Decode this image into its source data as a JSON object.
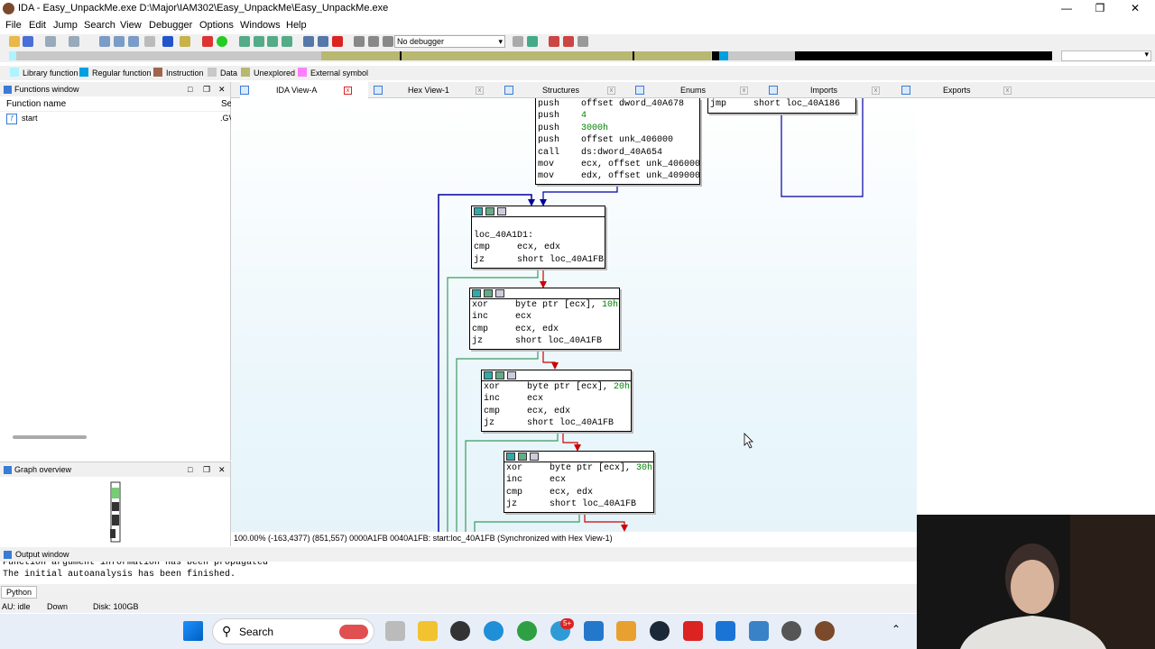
{
  "window": {
    "title": "IDA - Easy_UnpackMe.exe D:\\Major\\IAM302\\Easy_UnpackMe\\Easy_UnpackMe.exe"
  },
  "menu": [
    "File",
    "Edit",
    "Jump",
    "Search",
    "View",
    "Debugger",
    "Options",
    "Windows",
    "Help"
  ],
  "toolbar": {
    "debugger_select": "No debugger"
  },
  "legend": [
    {
      "label": "Library function",
      "color": "#aef4ff"
    },
    {
      "label": "Regular function",
      "color": "#00a0e0"
    },
    {
      "label": "Instruction",
      "color": "#a0644e"
    },
    {
      "label": "Data",
      "color": "#c8c8c8"
    },
    {
      "label": "Unexplored",
      "color": "#b8b870"
    },
    {
      "label": "External symbol",
      "color": "#ff80ff"
    }
  ],
  "tabs": [
    "IDA View-A",
    "Hex View-1",
    "Structures",
    "Enums",
    "Imports",
    "Exports"
  ],
  "functions_window": {
    "title": "Functions window",
    "col_name": "Function name",
    "col_seg": "Se",
    "rows": [
      {
        "name": "start",
        "seg": ".GV"
      }
    ]
  },
  "graph_overview": {
    "title": "Graph overview"
  },
  "blocks": {
    "top": [
      {
        "m": "push",
        "o": "offset dword_40A678"
      },
      {
        "m": "push",
        "o": "4"
      },
      {
        "m": "push",
        "o": "3000h"
      },
      {
        "m": "push",
        "o": "offset unk_406000"
      },
      {
        "m": "call",
        "o": "ds:dword_40A654"
      },
      {
        "m": "mov",
        "o": "ecx, offset unk_406000"
      },
      {
        "m": "mov",
        "o": "edx, offset unk_409000"
      }
    ],
    "jmp": {
      "m": "jmp",
      "o": "short loc_40A186"
    },
    "loc": {
      "label": "loc_40A1D1:",
      "lines": [
        {
          "m": "cmp",
          "o": "ecx, edx"
        },
        {
          "m": "jz",
          "o": "short loc_40A1FB"
        }
      ]
    },
    "xor10": [
      {
        "m": "xor",
        "o": "byte ptr [ecx], ",
        "v": "10h"
      },
      {
        "m": "inc",
        "o": "ecx"
      },
      {
        "m": "cmp",
        "o": "ecx, edx"
      },
      {
        "m": "jz",
        "o": "short loc_40A1FB"
      }
    ],
    "xor20": [
      {
        "m": "xor",
        "o": "byte ptr [ecx], ",
        "v": "20h"
      },
      {
        "m": "inc",
        "o": "ecx"
      },
      {
        "m": "cmp",
        "o": "ecx, edx"
      },
      {
        "m": "jz",
        "o": "short loc_40A1FB"
      }
    ],
    "xor30": [
      {
        "m": "xor",
        "o": "byte ptr [ecx], ",
        "v": "30h"
      },
      {
        "m": "inc",
        "o": "ecx"
      },
      {
        "m": "cmp",
        "o": "ecx, edx"
      },
      {
        "m": "jz",
        "o": "short loc_40A1FB"
      }
    ]
  },
  "status_line": "100.00% (-163,4377) (851,557) 0000A1FB 0040A1FB: start:loc_40A1FB (Synchronized with Hex View-1)",
  "output": {
    "title": "Output window",
    "lines": [
      "Function argument information has been propagated",
      "The initial autoanalysis has been finished."
    ],
    "tab": "Python"
  },
  "statusbar": {
    "au": "AU:  idle",
    "dir": "Down",
    "disk": "Disk: 100GB"
  },
  "taskbar": {
    "search": "Search",
    "badge": "5+"
  }
}
